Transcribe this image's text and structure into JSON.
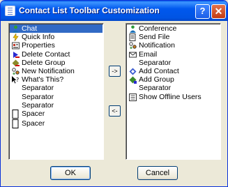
{
  "window": {
    "title": "Contact List Toolbar Customization",
    "help_label": "?",
    "close_label": "✕"
  },
  "available_items": [
    {
      "label": "Chat",
      "icon": "chat-icon",
      "selected": true
    },
    {
      "label": "Quick Info",
      "icon": "lightning-icon"
    },
    {
      "label": "Properties",
      "icon": "properties-icon"
    },
    {
      "label": "Delete Contact",
      "icon": "delete-contact-icon"
    },
    {
      "label": "Delete Group",
      "icon": "delete-group-icon"
    },
    {
      "label": "New Notification",
      "icon": "new-notification-icon"
    },
    {
      "label": "What's This?",
      "icon": "whats-this-icon"
    },
    {
      "label": "Separator",
      "icon": ""
    },
    {
      "label": "Separator",
      "icon": ""
    },
    {
      "label": "Separator",
      "icon": ""
    },
    {
      "label": "Spacer",
      "icon": "spacer-icon"
    },
    {
      "label": "Spacer",
      "icon": "spacer-icon"
    }
  ],
  "current_items": [
    {
      "label": "Conference",
      "icon": "conference-icon"
    },
    {
      "label": "Send File",
      "icon": "send-file-icon"
    },
    {
      "label": "Notification",
      "icon": "notification-icon"
    },
    {
      "label": "Email",
      "icon": "email-icon"
    },
    {
      "label": "Separator",
      "icon": ""
    },
    {
      "label": "Add Contact",
      "icon": "add-contact-icon"
    },
    {
      "label": "Add Group",
      "icon": "add-group-icon"
    },
    {
      "label": "Separator",
      "icon": ""
    },
    {
      "label": "Show Offline Users",
      "icon": "show-offline-users-icon"
    }
  ],
  "buttons": {
    "move_right": "->",
    "move_left": "<-",
    "ok": "OK",
    "cancel": "Cancel"
  },
  "colors": {
    "selection": "#316ac5",
    "titlebar": "#0054e3",
    "dialog_bg": "#ece9d8"
  }
}
